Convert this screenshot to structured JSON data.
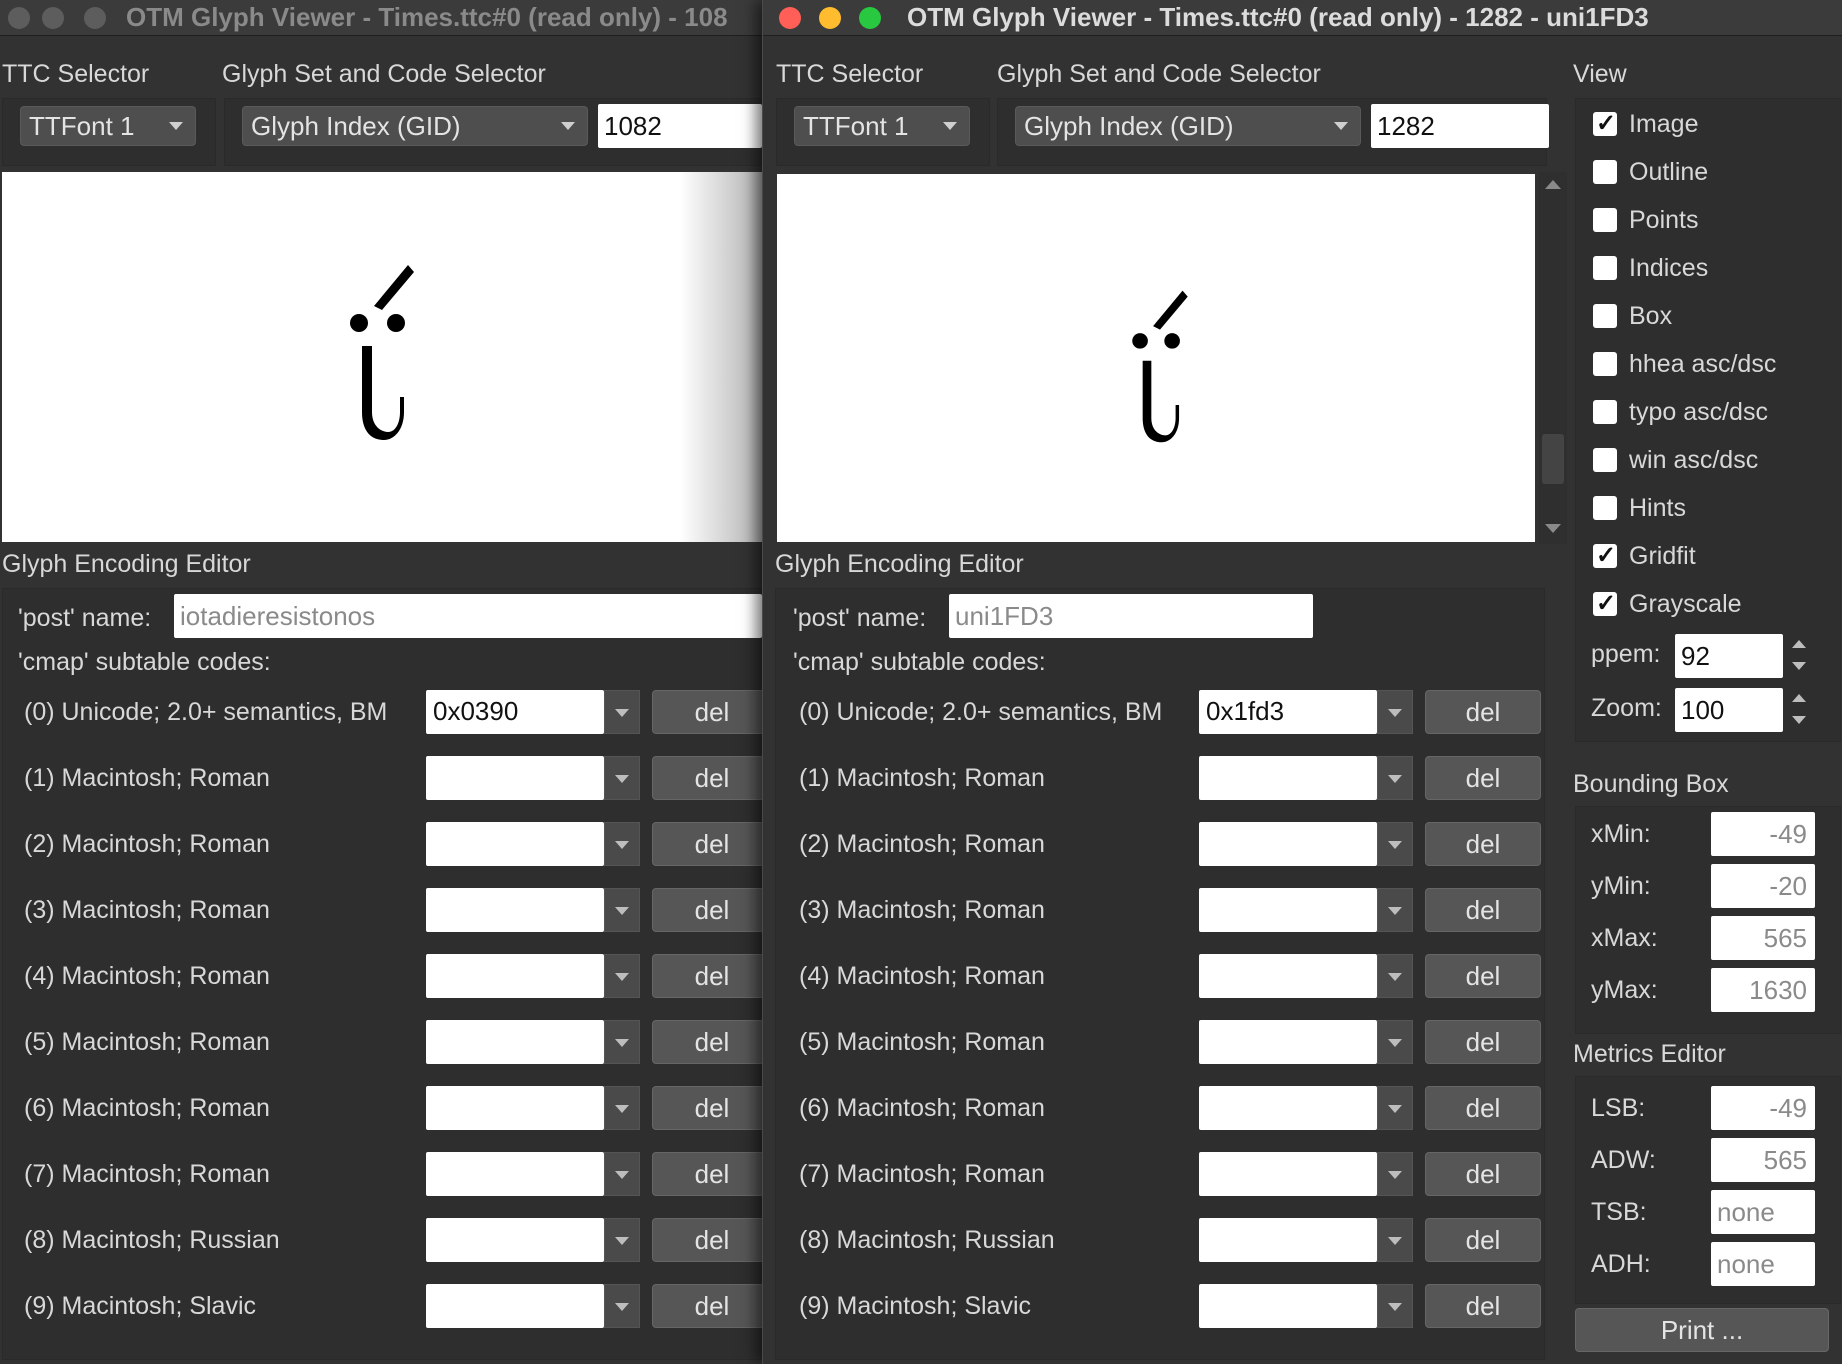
{
  "colors": {
    "close": "#ff5f57",
    "minimize": "#febc2e",
    "zoom": "#28c840",
    "inactive_light": "#5d5d5d",
    "window_bg": "#323232"
  },
  "back_window": {
    "title": "OTM Glyph Viewer - Times.ttc#0 (read only) - 108",
    "ttc_selector_label": "TTC Selector",
    "ttc_value": "TTFont 1",
    "glyph_set_label": "Glyph Set and Code Selector",
    "glyph_set_value": "Glyph Index (GID)",
    "gid_value": "1082",
    "encoding_label": "Glyph Encoding Editor",
    "post_name_label": "'post' name:",
    "post_name_value": "iotadieresistonos",
    "cmap_label": "'cmap' subtable codes:",
    "cmap_rows": [
      {
        "label": "(0) Unicode; 2.0+ semantics, BM",
        "code": "0x0390",
        "del": "del"
      },
      {
        "label": "(1) Macintosh; Roman",
        "code": "",
        "del": "del"
      },
      {
        "label": "(2) Macintosh; Roman",
        "code": "",
        "del": "del"
      },
      {
        "label": "(3) Macintosh; Roman",
        "code": "",
        "del": "del"
      },
      {
        "label": "(4) Macintosh; Roman",
        "code": "",
        "del": "del"
      },
      {
        "label": "(5) Macintosh; Roman",
        "code": "",
        "del": "del"
      },
      {
        "label": "(6) Macintosh; Roman",
        "code": "",
        "del": "del"
      },
      {
        "label": "(7) Macintosh; Roman",
        "code": "",
        "del": "del"
      },
      {
        "label": "(8) Macintosh; Russian",
        "code": "",
        "del": "del"
      },
      {
        "label": "(9) Macintosh; Slavic",
        "code": "",
        "del": "del"
      }
    ]
  },
  "front_window": {
    "title": "OTM Glyph Viewer - Times.ttc#0 (read only) - 1282 - uni1FD3",
    "ttc_selector_label": "TTC Selector",
    "ttc_value": "TTFont 1",
    "glyph_set_label": "Glyph Set and Code Selector",
    "glyph_set_value": "Glyph Index (GID)",
    "gid_value": "1282",
    "encoding_label": "Glyph Encoding Editor",
    "post_name_label": "'post' name:",
    "post_name_value": "uni1FD3",
    "cmap_label": "'cmap' subtable codes:",
    "cmap_rows": [
      {
        "label": "(0) Unicode; 2.0+ semantics, BM",
        "code": "0x1fd3",
        "del": "del"
      },
      {
        "label": "(1) Macintosh; Roman",
        "code": "",
        "del": "del"
      },
      {
        "label": "(2) Macintosh; Roman",
        "code": "",
        "del": "del"
      },
      {
        "label": "(3) Macintosh; Roman",
        "code": "",
        "del": "del"
      },
      {
        "label": "(4) Macintosh; Roman",
        "code": "",
        "del": "del"
      },
      {
        "label": "(5) Macintosh; Roman",
        "code": "",
        "del": "del"
      },
      {
        "label": "(6) Macintosh; Roman",
        "code": "",
        "del": "del"
      },
      {
        "label": "(7) Macintosh; Roman",
        "code": "",
        "del": "del"
      },
      {
        "label": "(8) Macintosh; Russian",
        "code": "",
        "del": "del"
      },
      {
        "label": "(9) Macintosh; Slavic",
        "code": "",
        "del": "del"
      }
    ],
    "view": {
      "label": "View",
      "options": [
        {
          "label": "Image",
          "checked": true
        },
        {
          "label": "Outline",
          "checked": false
        },
        {
          "label": "Points",
          "checked": false
        },
        {
          "label": "Indices",
          "checked": false
        },
        {
          "label": "Box",
          "checked": false
        },
        {
          "label": "hhea asc/dsc",
          "checked": false
        },
        {
          "label": "typo asc/dsc",
          "checked": false
        },
        {
          "label": "win asc/dsc",
          "checked": false
        },
        {
          "label": "Hints",
          "checked": false
        },
        {
          "label": "Gridfit",
          "checked": true
        },
        {
          "label": "Grayscale",
          "checked": true
        }
      ],
      "ppem_label": "ppem:",
      "ppem_value": "92",
      "zoom_label": "Zoom:",
      "zoom_value": "100"
    },
    "bounding_box": {
      "label": "Bounding Box",
      "fields": [
        {
          "label": "xMin:",
          "value": "-49"
        },
        {
          "label": "yMin:",
          "value": "-20"
        },
        {
          "label": "xMax:",
          "value": "565"
        },
        {
          "label": "yMax:",
          "value": "1630"
        }
      ]
    },
    "metrics": {
      "label": "Metrics Editor",
      "fields": [
        {
          "label": "LSB:",
          "value": "-49"
        },
        {
          "label": "ADW:",
          "value": "565"
        },
        {
          "label": "TSB:",
          "value": "none"
        },
        {
          "label": "ADH:",
          "value": "none"
        }
      ]
    },
    "print_label": "Print ..."
  }
}
